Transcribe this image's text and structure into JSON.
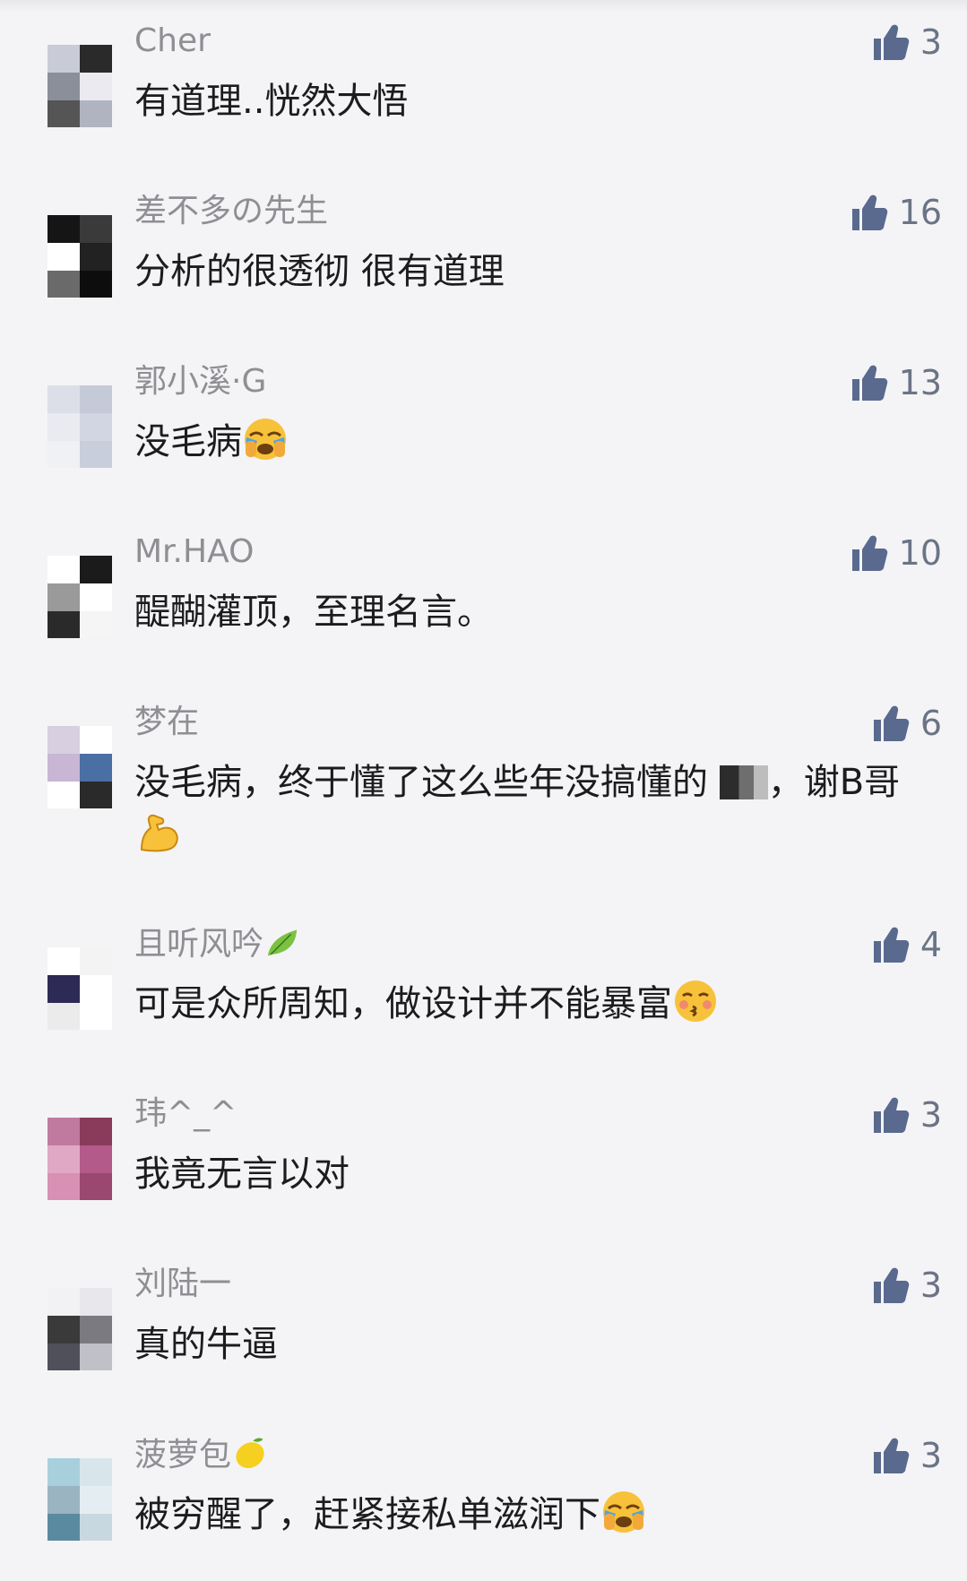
{
  "colors": {
    "background": "#f4f4f6",
    "username": "#8e8e93",
    "text": "#1c1c1e",
    "like": "#5a6a8e"
  },
  "comments": [
    {
      "username": "Cher",
      "text": "有道理..恍然大悟",
      "likes": "3",
      "avatar_colors": [
        "#c9ccd6",
        "#2a2a2a",
        "#8a8f99",
        "#eaeaf0",
        "#555555",
        "#b0b4c0"
      ]
    },
    {
      "username": "差不多の先生",
      "text": "分析的很透彻 很有道理",
      "likes": "16",
      "avatar_colors": [
        "#151515",
        "#3a3a3a",
        "#ffffff",
        "#222222",
        "#6a6a6a",
        "#0d0d0d"
      ]
    },
    {
      "username": "郭小溪·G",
      "text": "没毛病",
      "emoji": "crying-face-emoji",
      "likes": "13",
      "avatar_colors": [
        "#dcdfe8",
        "#c5cad8",
        "#e9ebf1",
        "#d2d6e2",
        "#f0f1f5",
        "#c9cedc"
      ]
    },
    {
      "username": "Mr.HAO",
      "text": "醍醐灌顶，至理名言。",
      "likes": "10",
      "avatar_colors": [
        "#ffffff",
        "#1b1b1b",
        "#9a9a9a",
        "#ffffff",
        "#2a2a2a",
        "#f5f5f5"
      ]
    },
    {
      "username": "梦在",
      "text_before": "没毛病，终于懂了这么些年没搞懂的 ",
      "text_after": "，谢B哥",
      "emoji": "flexed-biceps-emoji",
      "likes": "6",
      "avatar_colors": [
        "#d8cfe0",
        "#ffffff",
        "#c8b6d4",
        "#4a6fa5",
        "#ffffff",
        "#2a2a2a"
      ]
    },
    {
      "username": "且听风吟",
      "username_emoji": "leaf-emoji",
      "text": "可是众所周知，做设计并不能暴富",
      "emoji": "kissing-face-emoji",
      "likes": "4",
      "avatar_colors": [
        "#ffffff",
        "#f3f3f3",
        "#2d2a55",
        "#ffffff",
        "#ebebeb",
        "#ffffff"
      ]
    },
    {
      "username": "玮^_^",
      "text": "我竟无言以对",
      "likes": "3",
      "avatar_colors": [
        "#c07aa0",
        "#8a3a5a",
        "#e0a8c4",
        "#b45a8a",
        "#d890b4",
        "#9a4870"
      ]
    },
    {
      "username": "刘陆一",
      "text": "真的牛逼",
      "likes": "3",
      "avatar_colors": [
        "#f2f2f4",
        "#e8e8ec",
        "#3a3a3a",
        "#7a7a80",
        "#50505a",
        "#c0c0c8"
      ]
    },
    {
      "username": "菠萝包",
      "username_emoji": "lemon-emoji",
      "text": "被穷醒了，赶紧接私单滋润下",
      "emoji": "crying-face-emoji",
      "likes": "3",
      "avatar_colors": [
        "#a8d0dc",
        "#d8e6ec",
        "#9ab4c2",
        "#e4eef2",
        "#5a8aa0",
        "#c8d8e0"
      ]
    }
  ]
}
